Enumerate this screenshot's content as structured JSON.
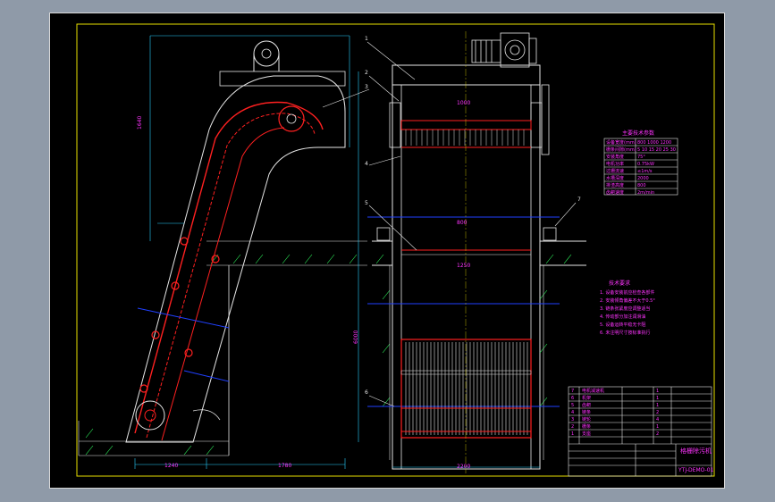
{
  "drawing": {
    "title_block": {
      "name": "格栅除污机",
      "drawing_no": "YTJ-DEMO-01"
    },
    "parameter_table": {
      "title": "主要技术参数",
      "rows": [
        [
          "设备宽度(mm)",
          "800 1000 1200"
        ],
        [
          "栅条间隙(mm)",
          "5 10 15 20 25 30"
        ],
        [
          "安装角度",
          "75°"
        ],
        [
          "电机功率",
          "0.75kW"
        ],
        [
          "过栅流速",
          "≤1m/s"
        ],
        [
          "水槽深度",
          "2000"
        ],
        [
          "排渣高度",
          "800"
        ],
        [
          "齿耙速度",
          "2m/min"
        ]
      ]
    },
    "notes": {
      "title": "技术要求",
      "lines": [
        "1. 设备安装前应检查各部件",
        "2. 安装倾角偏差不大于0.5°",
        "3. 链条张紧度应调整适当",
        "4. 传动部分加注润滑油",
        "5. 设备运转平稳无卡阻",
        "6. 未注明尺寸按标准执行"
      ]
    },
    "parts_list": [
      [
        "7",
        "电机减速机",
        "1"
      ],
      [
        "6",
        "机架",
        "1"
      ],
      [
        "5",
        "齿耙",
        "1"
      ],
      [
        "4",
        "链条",
        "2"
      ],
      [
        "3",
        "链轮",
        "4"
      ],
      [
        "2",
        "栅条",
        "1"
      ],
      [
        "1",
        "支座",
        "2"
      ]
    ],
    "dimensions": {
      "d1": "1240",
      "d2": "1780",
      "d3": "1640",
      "d4": "6000",
      "d5": "1000",
      "d6": "800",
      "d7": "1250",
      "d8": "2200"
    },
    "callouts": [
      "1",
      "2",
      "3",
      "4",
      "5",
      "6",
      "7"
    ],
    "colors": {
      "background": "#000000",
      "line_white": "#e6e6e6",
      "line_red": "#ff2020",
      "line_cyan": "#28d0ff",
      "line_blue": "#2040ff",
      "line_green": "#30ff60",
      "line_yellow": "#e8e000",
      "line_magenta": "#ff33ff"
    }
  }
}
